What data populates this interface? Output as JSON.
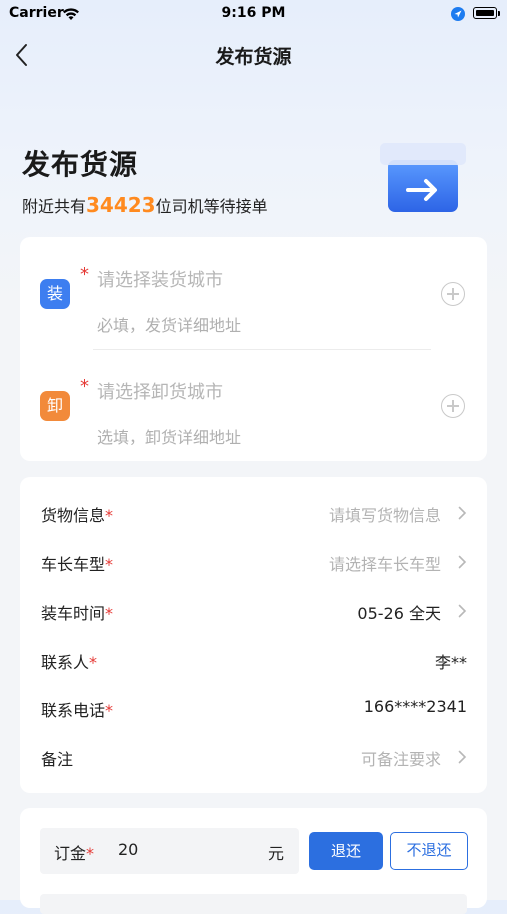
{
  "status_bar": {
    "carrier": "Carrier",
    "time": "9:16 PM"
  },
  "nav": {
    "title": "发布货源"
  },
  "hero": {
    "title": "发布货源",
    "subtitle_prefix": "附近共有",
    "driver_count": "34423",
    "subtitle_suffix": "位司机等待接单"
  },
  "address": {
    "load": {
      "badge": "装",
      "required": "*",
      "city_placeholder": "请选择装货城市",
      "detail_placeholder": "必填，发货详细地址"
    },
    "unload": {
      "badge": "卸",
      "required": "*",
      "city_placeholder": "请选择卸货城市",
      "detail_placeholder": "选填，卸货详细地址"
    }
  },
  "info": {
    "cargo": {
      "label": "货物信息",
      "star": "*",
      "value": "请填写货物信息"
    },
    "vehicle": {
      "label": "车长车型",
      "star": "*",
      "value": "请选择车长车型"
    },
    "load_time": {
      "label": "装车时间",
      "star": "*",
      "value": "05-26 全天"
    },
    "contact": {
      "label": "联系人",
      "star": "*",
      "value": "李**"
    },
    "phone": {
      "label": "联系电话",
      "star": "*",
      "value": "166****2341"
    },
    "remark": {
      "label": "备注",
      "value": "可备注要求"
    }
  },
  "deposit": {
    "label": "订金",
    "star": "*",
    "amount": "20",
    "unit": "元",
    "refund_label": "退还",
    "no_refund_label": "不退还"
  },
  "colors": {
    "accent": "#2c6fe0",
    "highlight": "#ff8a1f",
    "required": "#e53935",
    "load_badge": "#3d7ef0",
    "unload_badge": "#f28a3a"
  }
}
